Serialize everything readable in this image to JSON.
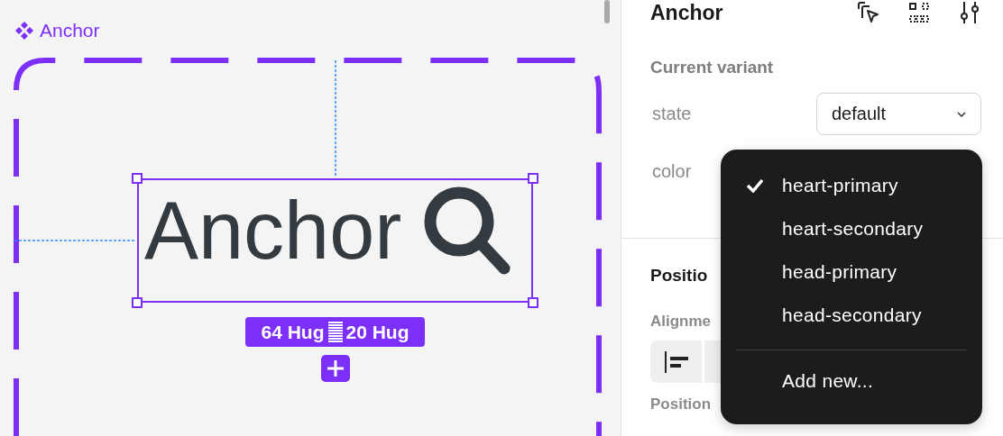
{
  "canvas": {
    "component_label": "Anchor",
    "element": {
      "text": "Anchor"
    },
    "size_badge": {
      "width": "64 Hug",
      "height": "20 Hug"
    }
  },
  "panel": {
    "title": "Anchor",
    "section": "Current variant",
    "properties": [
      {
        "label": "state",
        "value": "default"
      },
      {
        "label": "color"
      }
    ],
    "position_heading": "Positio",
    "alignment_label": "Alignme",
    "position_label": "Position"
  },
  "menu": {
    "items": [
      {
        "label": "heart-primary",
        "selected": true
      },
      {
        "label": "heart-secondary",
        "selected": false
      },
      {
        "label": "head-primary",
        "selected": false
      },
      {
        "label": "head-secondary",
        "selected": false
      }
    ],
    "action": "Add new..."
  }
}
